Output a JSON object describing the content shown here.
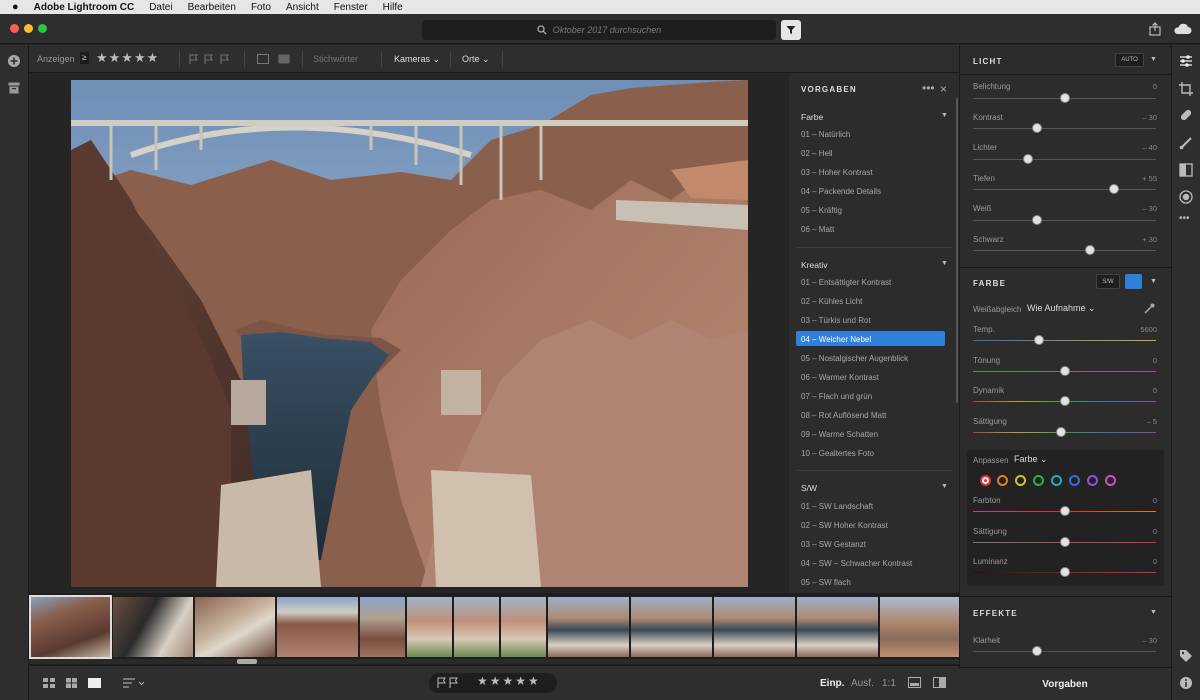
{
  "menubar": {
    "app": "Adobe Lightroom CC",
    "items": [
      "Datei",
      "Bearbeiten",
      "Foto",
      "Ansicht",
      "Fenster",
      "Hilfe"
    ]
  },
  "search": {
    "placeholder": "Oktober 2017 durchsuchen"
  },
  "toolbar": {
    "show_label": "Anzeigen",
    "keywords": "Stichwörter",
    "cameras": "Kameras",
    "places": "Orte"
  },
  "presets": {
    "title": "VORGABEN",
    "groups": [
      {
        "name": "Farbe",
        "items": [
          "01 – Natürlich",
          "02 – Hell",
          "03 – Hoher Kontrast",
          "04 – Packende Details",
          "05 – Kräftig",
          "06 – Matt"
        ]
      },
      {
        "name": "Kreativ",
        "items": [
          "01 – Entsättigter Kontrast",
          "02 – Kühles Licht",
          "03 – Türkis und Rot",
          "04 – Weicher Nebel",
          "05 – Nostalgischer Augenblick",
          "06 – Warmer Kontrast",
          "07 – Flach und grün",
          "08 – Rot Auflösend Matt",
          "09 – Warme Schatten",
          "10 – Gealtertes Foto"
        ]
      },
      {
        "name": "S/W",
        "items": [
          "01 – SW Landschaft",
          "02 – SW Hoher Kontrast",
          "03 – SW Gestanzt",
          "04 – SW – Schwacher Kontrast",
          "05 – SW flach"
        ]
      }
    ],
    "selected": "04 – Weicher Nebel"
  },
  "light": {
    "title": "LICHT",
    "auto": "AUTO",
    "sliders": [
      {
        "label": "Belichtung",
        "value": "0",
        "pos": 0.5
      },
      {
        "label": "Kontrast",
        "value": "– 30",
        "pos": 0.35
      },
      {
        "label": "Lichter",
        "value": "– 40",
        "pos": 0.3
      },
      {
        "label": "Tiefen",
        "value": "+ 55",
        "pos": 0.77
      },
      {
        "label": "Weiß",
        "value": "– 30",
        "pos": 0.35
      },
      {
        "label": "Schwarz",
        "value": "+ 30",
        "pos": 0.64
      }
    ]
  },
  "color": {
    "title": "FARBE",
    "bw": "S/W",
    "wb_label": "Weißabgleich",
    "wb_value": "Wie Aufnahme",
    "sliders": [
      {
        "label": "Temp.",
        "value": "5600",
        "pos": 0.36
      },
      {
        "label": "Tönung",
        "value": "0",
        "pos": 0.5
      },
      {
        "label": "Dynamik",
        "value": "0",
        "pos": 0.5
      },
      {
        "label": "Sättigung",
        "value": "– 5",
        "pos": 0.48
      }
    ],
    "mix_label": "Anpassen",
    "mix_value": "Farbe",
    "swatches": [
      "#e03030",
      "#e08020",
      "#d8c020",
      "#30b040",
      "#20b0b0",
      "#3070e0",
      "#9050e0",
      "#d050c0"
    ],
    "mix_sliders": [
      {
        "label": "Farbton",
        "value": "0",
        "pos": 0.5
      },
      {
        "label": "Sättigung",
        "value": "0",
        "pos": 0.5
      },
      {
        "label": "Luminanz",
        "value": "0",
        "pos": 0.5
      }
    ]
  },
  "effects": {
    "title": "EFFEKTE",
    "sliders": [
      {
        "label": "Klarheit",
        "value": "– 30",
        "pos": 0.35
      }
    ]
  },
  "bottom": {
    "fit": "Einp.",
    "fill": "Ausf.",
    "oneone": "1:1",
    "presets_button": "Vorgaben"
  }
}
